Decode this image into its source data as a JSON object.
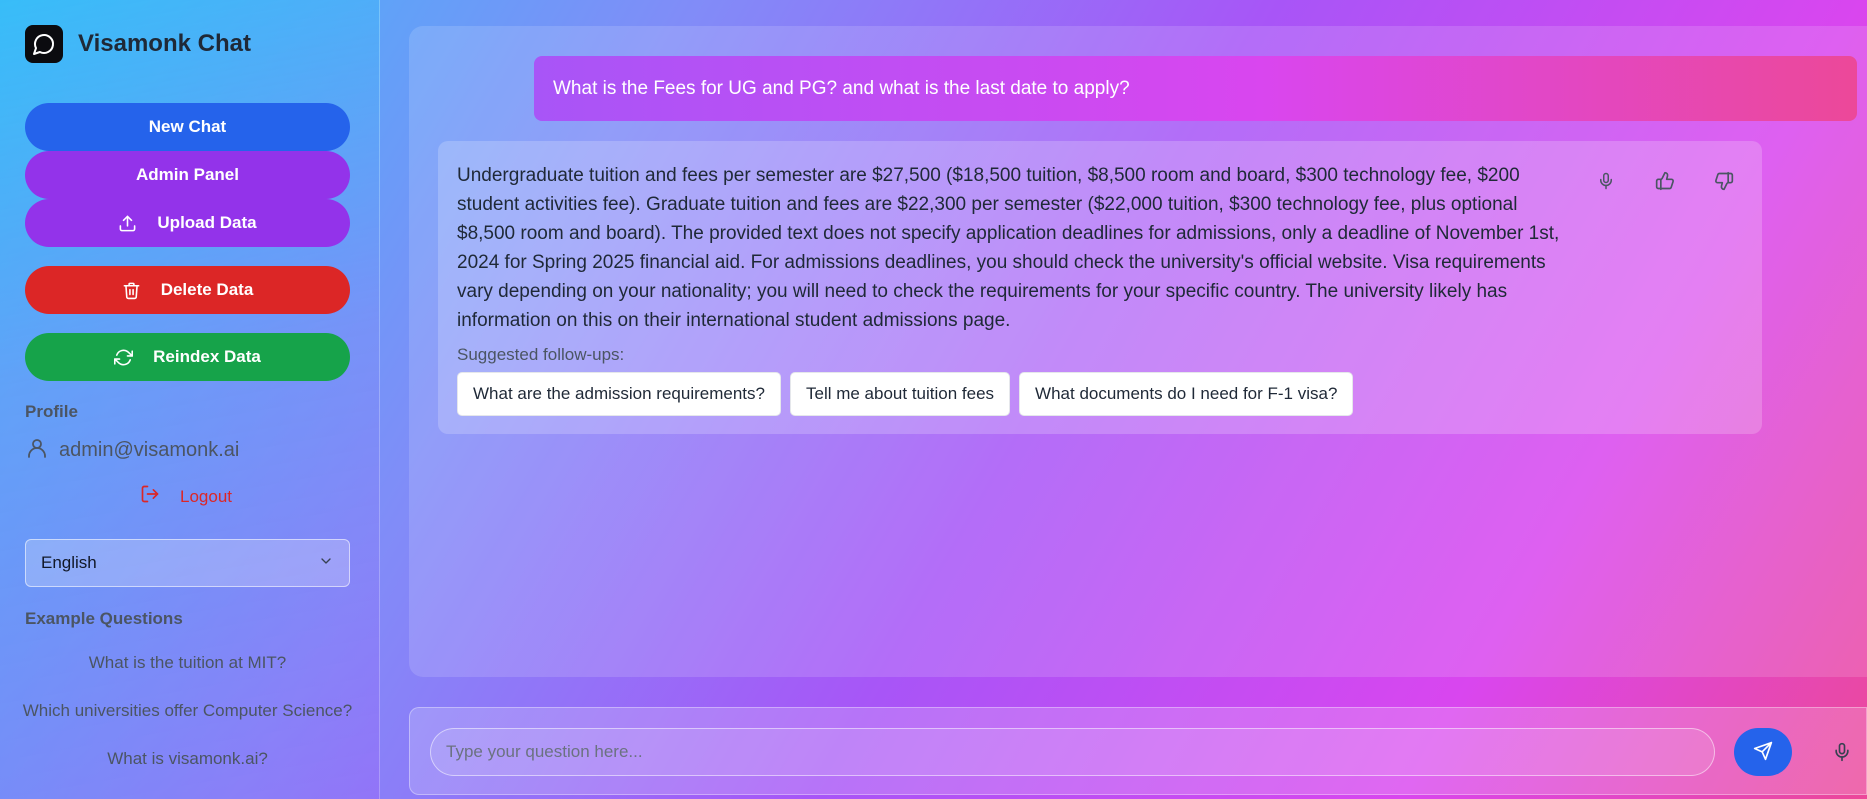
{
  "app": {
    "title": "Visamonk Chat"
  },
  "sidebar": {
    "buttons": {
      "new_chat": "New Chat",
      "admin_panel": "Admin Panel",
      "upload_data": "Upload Data",
      "delete_data": "Delete Data",
      "reindex_data": "Reindex Data"
    },
    "profile_label": "Profile",
    "profile_email": "admin@visamonk.ai",
    "logout_label": "Logout",
    "language": {
      "selected": "English"
    },
    "examples_label": "Example Questions",
    "examples": [
      "What is the tuition at MIT?",
      "Which universities offer Computer Science?",
      "What is visamonk.ai?"
    ]
  },
  "chat": {
    "user_message": "What is the Fees for UG and PG? and what is the last date to apply?",
    "bot_message": "Undergraduate tuition and fees per semester are $27,500 ($18,500 tuition, $8,500 room and board, $300 technology fee, $200 student activities fee). Graduate tuition and fees are $22,300 per semester ($22,000 tuition, $300 technology fee, plus optional $8,500 room and board). The provided text does not specify application deadlines for admissions, only a deadline of November 1st, 2024 for Spring 2025 financial aid. For admissions deadlines, you should check the university's official website. Visa requirements vary depending on your nationality; you will need to check the requirements for your specific country. The university likely has information on this on their international student admissions page.",
    "followups_label": "Suggested follow-ups:",
    "followups": [
      "What are the admission requirements?",
      "Tell me about tuition fees",
      "What documents do I need for F-1 visa?"
    ]
  },
  "input": {
    "placeholder": "Type your question here..."
  },
  "icons": {
    "logo": "chat-bubble-icon",
    "upload": "upload-icon",
    "delete": "trash-icon",
    "reindex": "refresh-icon",
    "profile": "user-icon",
    "logout": "logout-icon",
    "dropdown": "chevron-down-icon",
    "speak": "microphone-icon",
    "like": "thumbs-up-icon",
    "dislike": "thumbs-down-icon",
    "send": "send-icon",
    "voice": "microphone-icon"
  },
  "colors": {
    "primary_blue": "#2563eb",
    "purple": "#9333ea",
    "danger_red": "#dc2626",
    "success_green": "#16a34a"
  }
}
